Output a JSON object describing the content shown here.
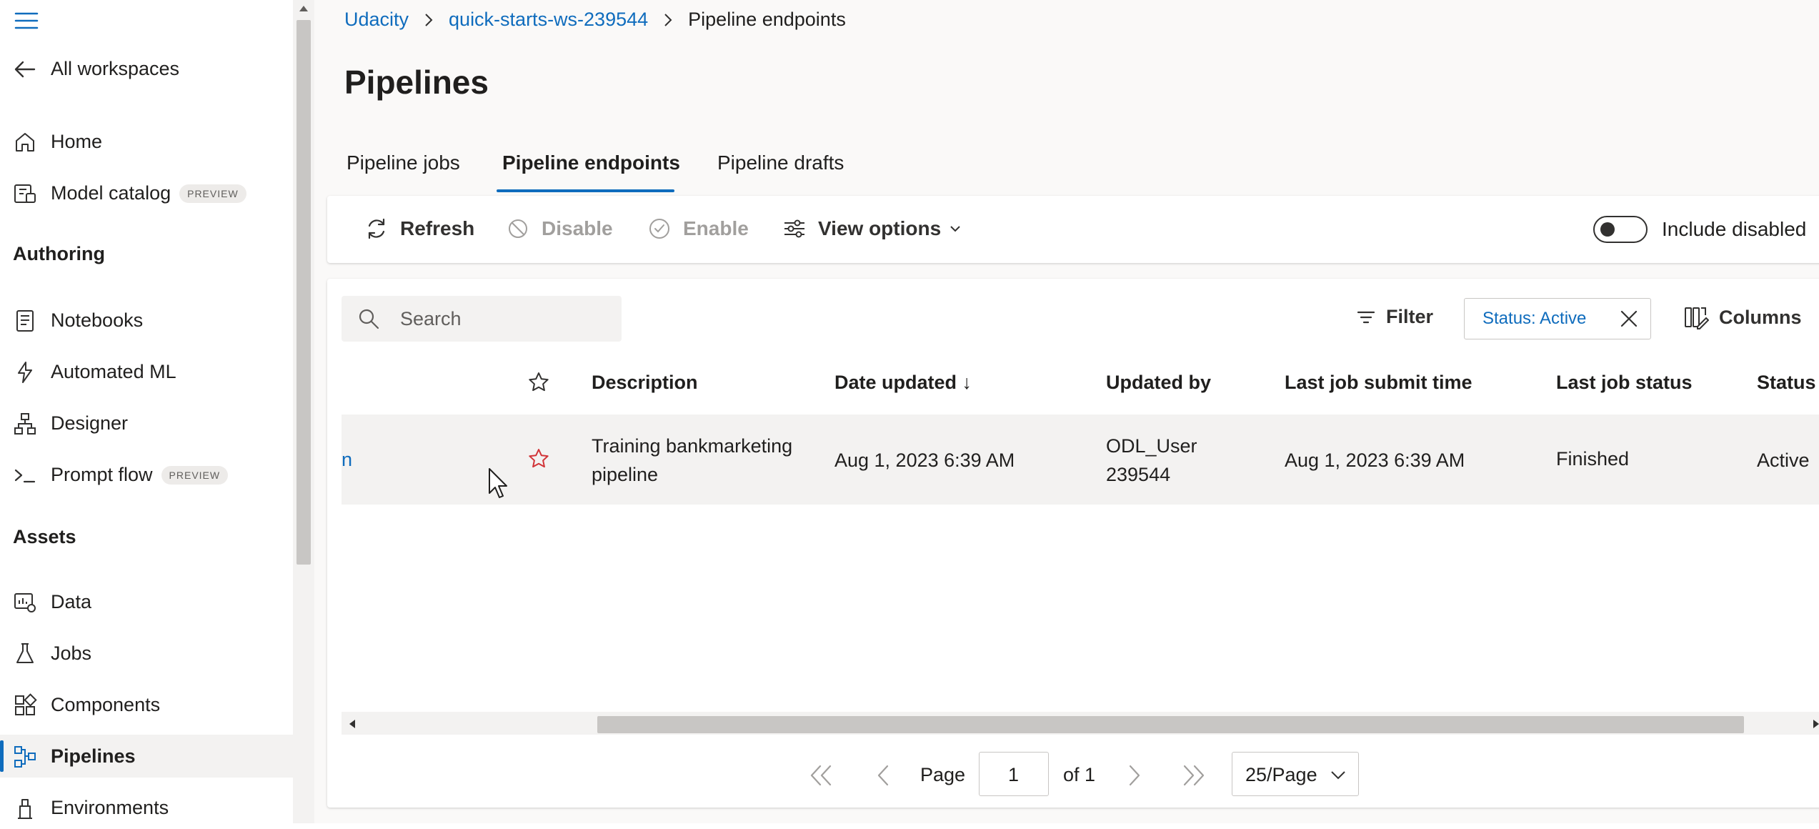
{
  "sidebar": {
    "back_label": "All workspaces",
    "items_top": [
      {
        "label": "Home",
        "icon": "home-icon"
      },
      {
        "label": "Model catalog",
        "icon": "model-catalog-icon",
        "badge": "PREVIEW"
      }
    ],
    "authoring_header": "Authoring",
    "authoring_items": [
      {
        "label": "Notebooks",
        "icon": "notebook-icon"
      },
      {
        "label": "Automated ML",
        "icon": "automated-ml-icon"
      },
      {
        "label": "Designer",
        "icon": "designer-icon"
      },
      {
        "label": "Prompt flow",
        "icon": "prompt-flow-icon",
        "badge": "PREVIEW"
      }
    ],
    "assets_header": "Assets",
    "assets_items": [
      {
        "label": "Data",
        "icon": "data-icon"
      },
      {
        "label": "Jobs",
        "icon": "jobs-icon"
      },
      {
        "label": "Components",
        "icon": "components-icon"
      },
      {
        "label": "Pipelines",
        "icon": "pipelines-icon",
        "active": true
      },
      {
        "label": "Environments",
        "icon": "environments-icon"
      }
    ]
  },
  "breadcrumb": [
    "Udacity",
    "quick-starts-ws-239544",
    "Pipeline endpoints"
  ],
  "page_title": "Pipelines",
  "tabs": [
    {
      "label": "Pipeline jobs"
    },
    {
      "label": "Pipeline endpoints",
      "selected": true
    },
    {
      "label": "Pipeline drafts"
    }
  ],
  "toolbar": {
    "refresh": "Refresh",
    "disable": "Disable",
    "enable": "Enable",
    "view_options": "View options",
    "include_disabled": "Include disabled",
    "include_disabled_on": false
  },
  "search": {
    "placeholder": "Search"
  },
  "filter": {
    "label": "Filter",
    "chip": "Status: Active",
    "columns": "Columns"
  },
  "table": {
    "headers": {
      "description": "Description",
      "date_updated": "Date updated",
      "updated_by": "Updated by",
      "last_job_submit_time": "Last job submit time",
      "last_job_status": "Last job status",
      "status": "Status"
    },
    "sort_indicator": "↓",
    "rows": [
      {
        "name_fragment": "n",
        "description_line1": "Training bankmarketing",
        "description_line2": "pipeline",
        "date_updated": "Aug 1, 2023 6:39 AM",
        "updated_by_line1": "ODL_User",
        "updated_by_line2": "239544",
        "last_job_submit_time": "Aug 1, 2023 6:39 AM",
        "last_job_status": "Finished",
        "status": "Active"
      }
    ]
  },
  "pagination": {
    "page_label": "Page",
    "page_value": "1",
    "of_label": "of 1",
    "page_size": "25/Page"
  },
  "colors": {
    "accent": "#0f6cbd",
    "favorite": "#d13438"
  }
}
